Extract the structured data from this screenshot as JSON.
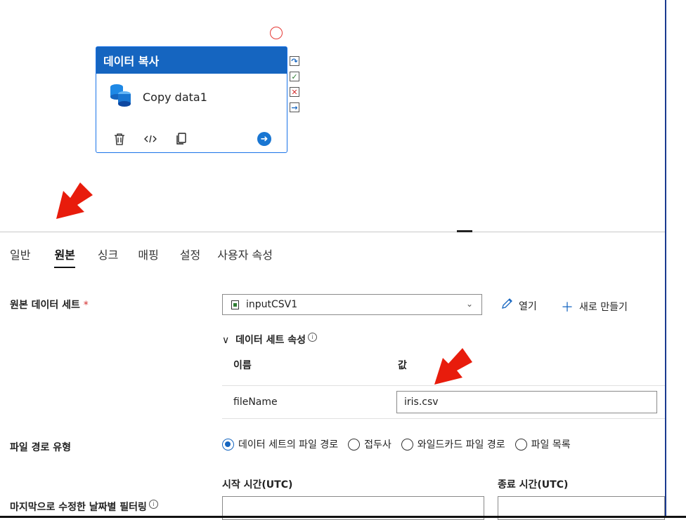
{
  "activity": {
    "header": "데이터 복사",
    "name": "Copy data1",
    "footer_icons": [
      "delete-icon",
      "code-icon",
      "copy-icon",
      "go-arrow-icon"
    ]
  },
  "ports": [
    "skip-icon",
    "success-check-icon",
    "failure-x-icon",
    "completion-arrow-icon"
  ],
  "tabs": [
    "일반",
    "원본",
    "싱크",
    "매핑",
    "설정",
    "사용자 속성"
  ],
  "active_tab": "원본",
  "source": {
    "dataset_label": "원본 데이터 세트",
    "required_mark": "*",
    "dataset_value": "inputCSV1",
    "open_label": "열기",
    "new_label": "새로 만들기",
    "props_header": "데이터 세트 속성",
    "col_name": "이름",
    "col_value": "값",
    "prop_name": "fileName",
    "prop_value": "iris.csv"
  },
  "file_path": {
    "label": "파일 경로 유형",
    "options": [
      "데이터 세트의 파일 경로",
      "접두사",
      "와일드카드 파일 경로",
      "파일 목록"
    ],
    "selected": "데이터 세트의 파일 경로"
  },
  "filter": {
    "label": "마지막으로 수정한 날짜별 필터링",
    "start_label": "시작 시간(UTC)",
    "end_label": "종료 시간(UTC)"
  },
  "colors": {
    "accent": "#1565c0",
    "arrow": "#e81c0c",
    "status": "#e53935"
  }
}
